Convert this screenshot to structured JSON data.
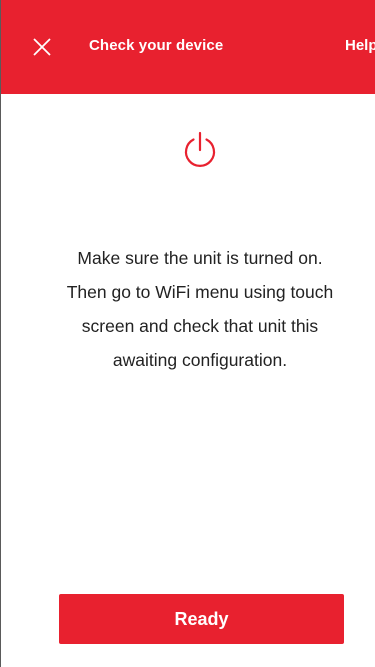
{
  "header": {
    "title": "Check your device",
    "help_label": "Help",
    "background_color": "#e8212f"
  },
  "icons": {
    "close": "close-icon",
    "power": "power-icon"
  },
  "message": {
    "lines": [
      "Make sure the unit is turned on.",
      "Then go to WiFi menu using touch",
      "screen and check that unit this",
      "awaiting configuration."
    ]
  },
  "actions": {
    "ready_label": "Ready",
    "accent_color": "#e8212f"
  }
}
